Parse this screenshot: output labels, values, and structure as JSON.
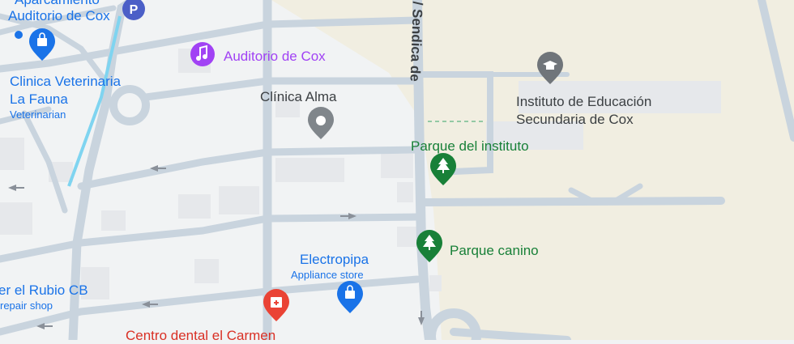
{
  "colors": {
    "park": "#f1eee1",
    "park_edge": "#e8e3cf",
    "road": "#c8d3dd",
    "road_edge": "#b9c6d2",
    "building": "#e4e6e9",
    "block": "#f6f6f7",
    "cycle": "#7cd3f0",
    "blue_pin": "#1a73e8",
    "purple_pin": "#a142f4",
    "green_pin": "#188038",
    "gray_pin": "#70757a",
    "red_pin": "#ea4335"
  },
  "road": {
    "name": "/ Sendica de"
  },
  "pois": {
    "aparcamiento": {
      "name_line1": "Aparcamiento",
      "name_line2": "Auditorio de Cox",
      "icon": "parking-icon"
    },
    "clinica_veterinaria": {
      "name_line1": "Clinica Veterinaria",
      "name_line2": "La Fauna",
      "category": "Veterinarian",
      "icon": "shopping-bag-icon"
    },
    "auditorio": {
      "name": "Auditorio de Cox",
      "icon": "music-note-icon"
    },
    "clinica_alma": {
      "name": "Clínica Alma",
      "icon": "generic-pin-icon"
    },
    "instituto": {
      "name_line1": "Instituto de Educación",
      "name_line2": "Secundaria de Cox",
      "icon": "graduation-cap-icon"
    },
    "parque_instituto": {
      "name": "Parque del instituto",
      "icon": "tree-icon"
    },
    "parque_canino": {
      "name": "Parque canino",
      "icon": "tree-icon"
    },
    "electropipa": {
      "name": "Electropipa",
      "category": "Appliance store",
      "icon": "shopping-bag-icon"
    },
    "rubio": {
      "name": "er el Rubio CB",
      "category": "repair shop"
    },
    "centro_dental": {
      "name": "Centro dental el Carmen",
      "icon": "medical-icon"
    }
  }
}
